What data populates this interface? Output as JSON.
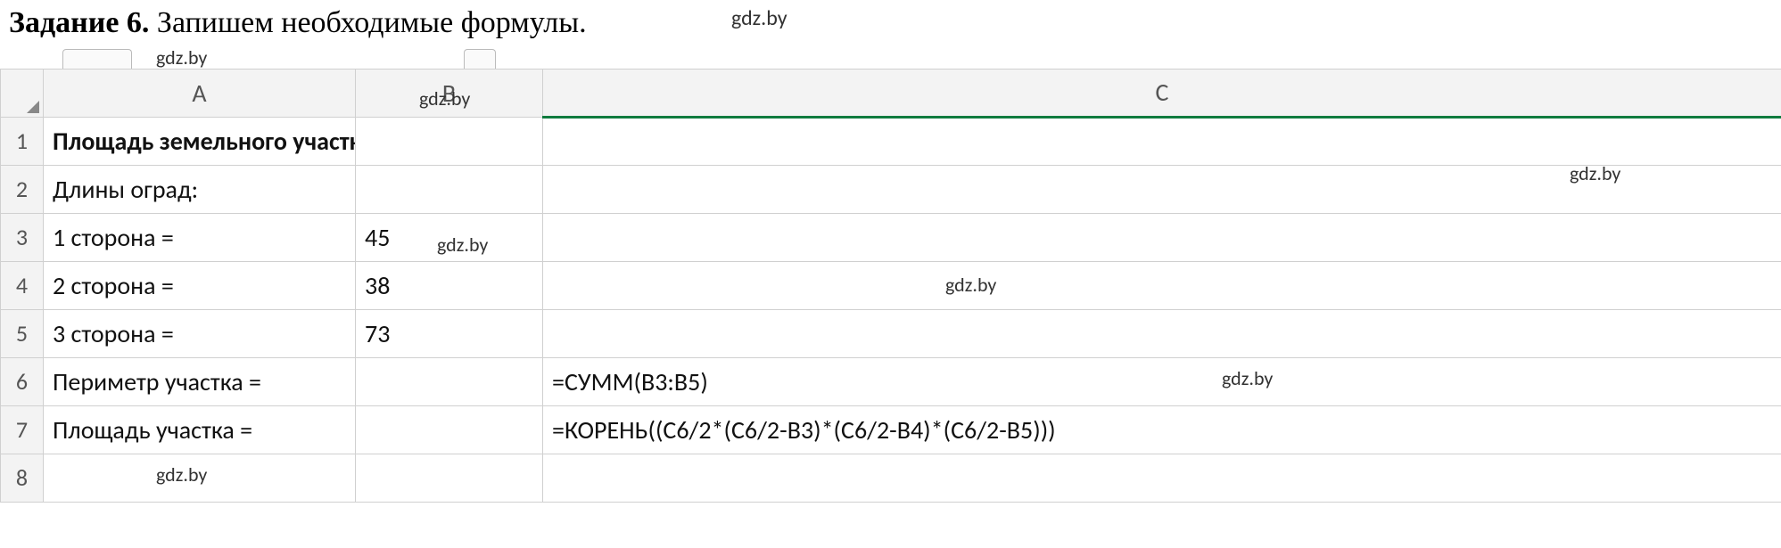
{
  "task": {
    "label": "Задание 6.",
    "text": "Запишем необходимые формулы."
  },
  "watermark": "gdz.by",
  "sheet": {
    "columnHeaders": {
      "corner": "",
      "A": "A",
      "B": "B",
      "C": "C"
    },
    "rows": [
      {
        "num": "1",
        "A": "Площадь земельного участка",
        "B": "",
        "C": ""
      },
      {
        "num": "2",
        "A": "Длины оград:",
        "B": "",
        "C": ""
      },
      {
        "num": "3",
        "A": "1 сторона =",
        "B": "45",
        "C": ""
      },
      {
        "num": "4",
        "A": "2 сторона =",
        "B": "38",
        "C": ""
      },
      {
        "num": "5",
        "A": "3 сторона =",
        "B": "73",
        "C": ""
      },
      {
        "num": "6",
        "A": "Периметр участка =",
        "B": "",
        "C": "=СУММ(B3:B5)"
      },
      {
        "num": "7",
        "A": "Площадь участка =",
        "B": "",
        "C": "=КОРЕНЬ((C6/2*(C6/2-B3)*(C6/2-B4)*(C6/2-B5)))"
      },
      {
        "num": "8",
        "A": "",
        "B": "",
        "C": ""
      }
    ]
  }
}
